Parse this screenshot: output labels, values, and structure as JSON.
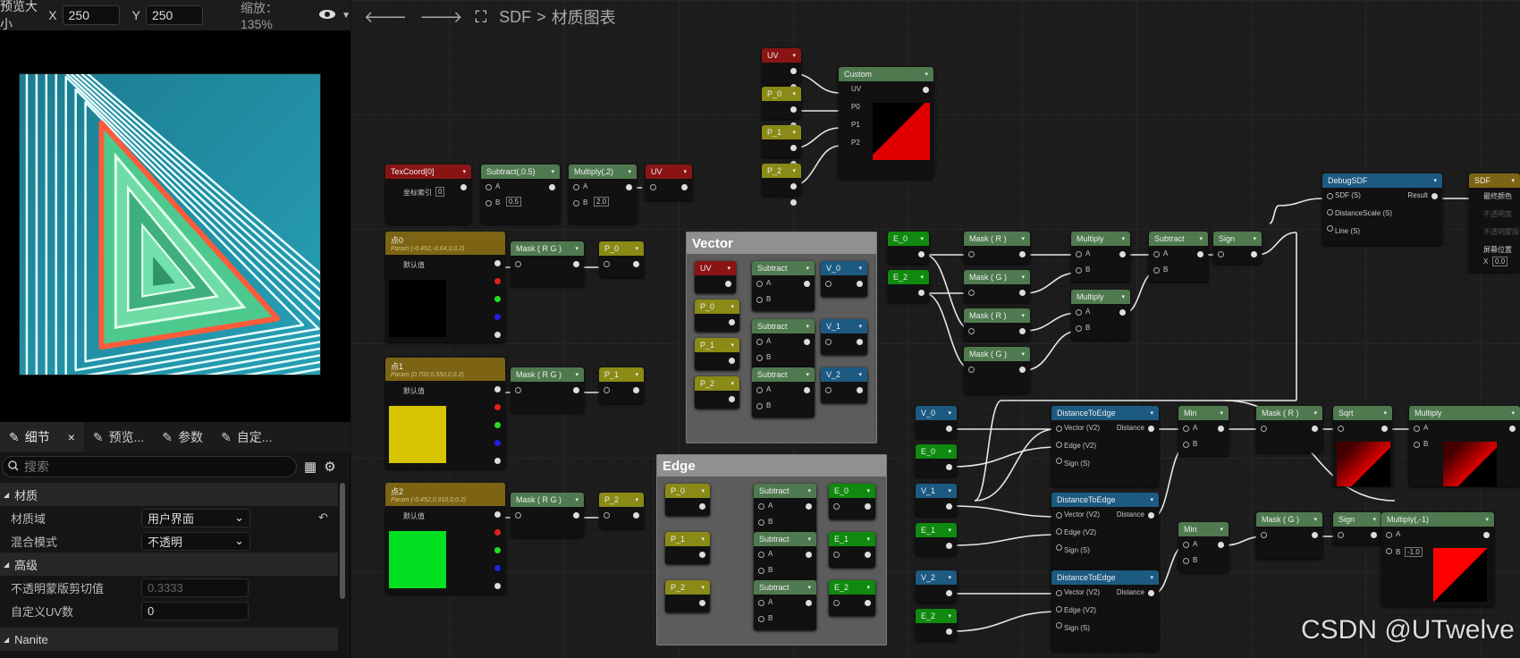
{
  "preview": {
    "size_label": "预览大小",
    "x_label": "X",
    "x_value": "250",
    "y_label": "Y",
    "y_value": "250",
    "zoom_label": "缩放：135%"
  },
  "breadcrumb": {
    "root": "SDF",
    "sep": ">",
    "current": "材质图表"
  },
  "tabs": [
    {
      "label": "细节",
      "close": "×"
    },
    {
      "label": "预览..."
    },
    {
      "label": "参数"
    },
    {
      "label": "自定..."
    }
  ],
  "search_placeholder": "搜索",
  "details": {
    "section_material": "材质",
    "domain_label": "材质域",
    "domain_value": "用户界面",
    "blend_label": "混合模式",
    "blend_value": "不透明",
    "section_advanced": "高级",
    "opacity_clip_label": "不透明蒙版剪切值",
    "opacity_clip_value": "0.3333",
    "custom_uv_label": "自定义UV数",
    "custom_uv_value": "0",
    "section_nanite": "Nanite"
  },
  "nodes": {
    "uv": "UV",
    "custom": "Custom",
    "custom_pins": [
      "UV",
      "P0",
      "P1",
      "P2"
    ],
    "p0": "P_0",
    "p1": "P_1",
    "p2": "P_2",
    "texcoord": "TexCoord[0]",
    "coord_index": "坐标索引",
    "coord_index_val": "0",
    "subtract05": "Subtract(,0.5)",
    "multiply2": "Multiply(,2)",
    "a": "A",
    "b": "B",
    "b05": "0.5",
    "b20": "2.0",
    "point0": "点0",
    "point0_param": "Param (-0.452,-0.64,0,0.2)",
    "default_value": "默认值",
    "point1": "点1",
    "point1_param": "Param (0.700,0.550,0,0.2)",
    "point2": "点2",
    "point2_param": "Param (-0.452,0.910,0,0.2)",
    "maskrg": "Mask ( R G )",
    "maskr": "Mask ( R )",
    "maskg": "Mask ( G )",
    "vector_comment": "Vector",
    "edge_comment": "Edge",
    "subtract": "Subtract",
    "v0": "V_0",
    "v1": "V_1",
    "v2": "V_2",
    "e0": "E_0",
    "e1": "E_1",
    "e2": "E_2",
    "multiply": "Multiply",
    "sign": "Sign",
    "min": "Min",
    "sqrt": "Sqrt",
    "multiply_neg": "Multiply(,-1)",
    "neg_val": "-1.0",
    "dte": "DistanceToEdge",
    "dte_pins": [
      "Vector (V2)",
      "Edge (V2)",
      "Sign (S)"
    ],
    "distance": "Distance",
    "debug": "DebugSDF",
    "debug_pins": [
      "SDF (S)",
      "DistanceScale (S)",
      "Line (S)"
    ],
    "result": "Result",
    "sdf_out": "SDF",
    "sdf_out_pins": [
      "最终颜色",
      "不透明度",
      "不透明蒙版",
      "屏幕位置"
    ],
    "sdf_x": "X",
    "sdf_x_val": "0.0"
  },
  "watermark": "CSDN @UTwelve"
}
